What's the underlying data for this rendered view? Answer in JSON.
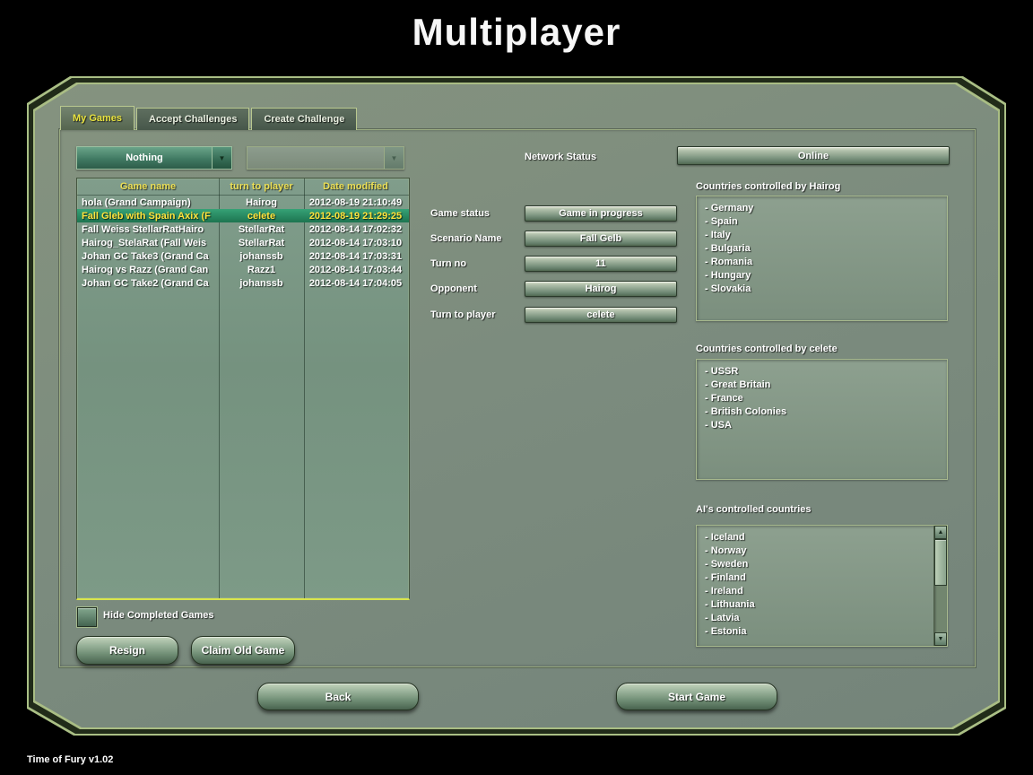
{
  "title": "Multiplayer",
  "footer": "Time of Fury v1.02",
  "tabs": [
    {
      "label": "My Games",
      "active": true
    },
    {
      "label": "Accept Challenges",
      "active": false
    },
    {
      "label": "Create Challenge",
      "active": false
    }
  ],
  "filters": {
    "selected": "Nothing",
    "secondary": ""
  },
  "icons": {
    "dropdown_arrow": "▼",
    "scroll_up": "▲",
    "scroll_down": "▼"
  },
  "network": {
    "label": "Network Status",
    "value": "Online"
  },
  "table": {
    "headers": [
      "Game name",
      "turn to player",
      "Date modified"
    ],
    "rows": [
      {
        "name": "hola (Grand Campaign)",
        "player": "Hairog",
        "date": "2012-08-19 21:10:49",
        "selected": false
      },
      {
        "name": "Fall Gleb with Spain Axix (F",
        "player": "celete",
        "date": "2012-08-19 21:29:25",
        "selected": true
      },
      {
        "name": "Fall Weiss StellarRatHairo",
        "player": "StellarRat",
        "date": "2012-08-14 17:02:32",
        "selected": false
      },
      {
        "name": "Hairog_StelaRat (Fall Weis",
        "player": "StellarRat",
        "date": "2012-08-14 17:03:10",
        "selected": false
      },
      {
        "name": "Johan GC Take3 (Grand Ca",
        "player": "johanssb",
        "date": "2012-08-14 17:03:31",
        "selected": false
      },
      {
        "name": "Hairog vs Razz (Grand Can",
        "player": "Razz1",
        "date": "2012-08-14 17:03:44",
        "selected": false
      },
      {
        "name": "Johan GC Take2 (Grand Ca",
        "player": "johanssb",
        "date": "2012-08-14 17:04:05",
        "selected": false
      }
    ]
  },
  "details": {
    "fields": [
      {
        "label": "Game status",
        "value": "Game in progress"
      },
      {
        "label": "Scenario Name",
        "value": "Fall Gelb"
      },
      {
        "label": "Turn no",
        "value": "11"
      },
      {
        "label": "Opponent",
        "value": "Hairog"
      },
      {
        "label": "Turn to player",
        "value": "celete"
      }
    ]
  },
  "panels": [
    {
      "title": "Countries controlled by Hairog",
      "items": [
        "- Germany",
        "- Spain",
        "- Italy",
        "- Bulgaria",
        "- Romania",
        "- Hungary",
        "- Slovakia"
      ],
      "scrollbar": false
    },
    {
      "title": "Countries controlled by celete",
      "items": [
        "- USSR",
        "- Great Britain",
        "- France",
        "- British Colonies",
        "- USA"
      ],
      "scrollbar": false
    },
    {
      "title": "AI's controlled countries",
      "items": [
        "- Iceland",
        "- Norway",
        "- Sweden",
        "- Finland",
        "- Ireland",
        "- Lithuania",
        "- Latvia",
        "- Estonia"
      ],
      "scrollbar": true
    }
  ],
  "checkbox": {
    "label": "Hide Completed Games",
    "checked": false
  },
  "buttons": {
    "resign": "Resign",
    "claim": "Claim Old Game",
    "back": "Back",
    "start": "Start Game"
  },
  "colors": {
    "panel": "#7c8c7e",
    "frame_line": "#aabf85",
    "tab_active_text": "#e9e33f",
    "table_header_text": "#ecdf55",
    "selected_row_bg": "#2a8a63",
    "selected_row_text": "#ffe33c",
    "table_bottom_line": "#d9e44c",
    "dropdown_teal": "#417a63"
  }
}
